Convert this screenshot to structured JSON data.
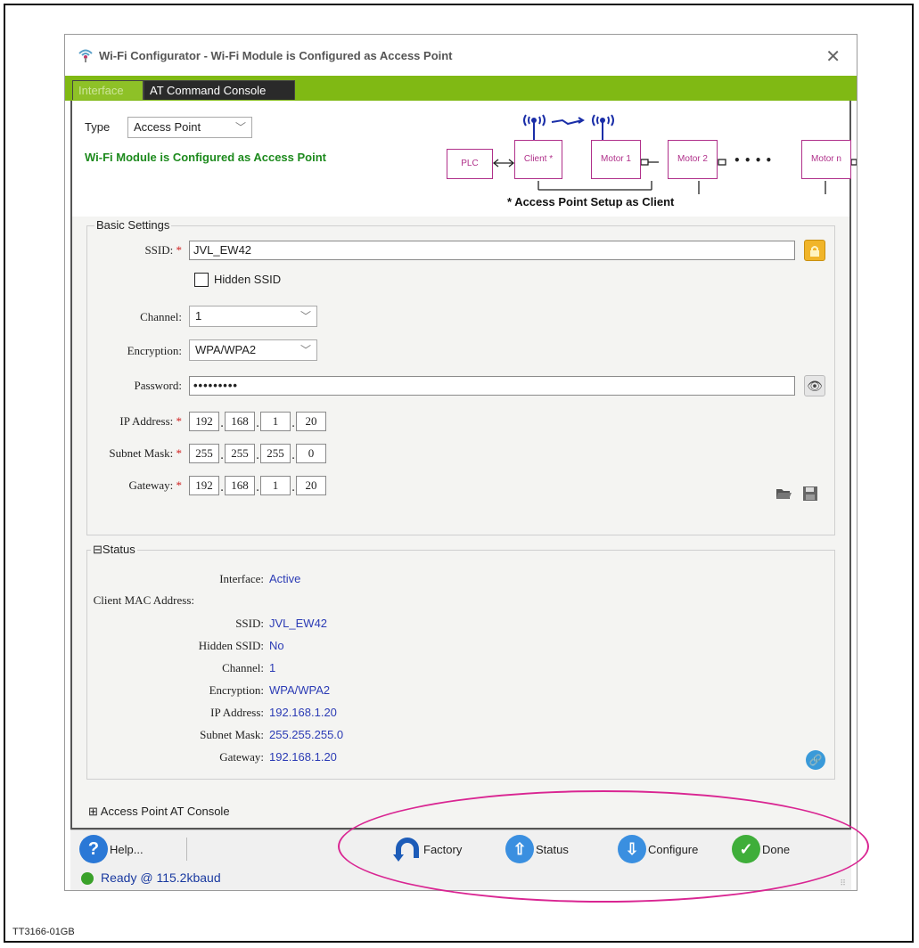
{
  "window": {
    "title": "Wi-Fi Configurator - Wi-Fi Module is Configured as Access Point",
    "tabs": [
      {
        "label": "Interface"
      },
      {
        "label": "AT Command Console"
      }
    ]
  },
  "top": {
    "type_label": "Type",
    "type_value": "Access Point",
    "config_message": "Wi-Fi Module is Configured as Access Point",
    "diagram": {
      "boxes": [
        "PLC",
        "Client *",
        "Motor 1",
        "Motor 2",
        "Motor n"
      ],
      "dots": "• • • •",
      "caption": "* Access Point Setup as Client"
    }
  },
  "basic": {
    "title": "Basic Settings",
    "ssid_label": "SSID:",
    "ssid_value": "JVL_EW42",
    "hidden_ssid_label": "Hidden SSID",
    "channel_label": "Channel:",
    "channel_value": "1",
    "encryption_label": "Encryption:",
    "encryption_value": "WPA/WPA2",
    "password_label": "Password:",
    "password_value": "•••••••••",
    "ip_label": "IP Address:",
    "ip": [
      "192",
      "168",
      "1",
      "20"
    ],
    "subnet_label": "Subnet Mask:",
    "subnet": [
      "255",
      "255",
      "255",
      "0"
    ],
    "gateway_label": "Gateway:",
    "gateway": [
      "192",
      "168",
      "1",
      "20"
    ],
    "required_marker": "*"
  },
  "status": {
    "title": "Status",
    "rows": [
      {
        "label": "Interface:",
        "value": "Active"
      },
      {
        "label": "Client MAC Address:",
        "value": ""
      },
      {
        "label": "SSID:",
        "value": "JVL_EW42"
      },
      {
        "label": "Hidden SSID:",
        "value": "No"
      },
      {
        "label": "Channel:",
        "value": "1"
      },
      {
        "label": "Encryption:",
        "value": "WPA/WPA2"
      },
      {
        "label": "IP Address:",
        "value": "192.168.1.20"
      },
      {
        "label": "Subnet Mask:",
        "value": "255.255.255.0"
      },
      {
        "label": "Gateway:",
        "value": "192.168.1.20"
      }
    ]
  },
  "ap_console": {
    "label": "Access Point AT Console"
  },
  "footer": {
    "help": "Help...",
    "factory": "Factory",
    "status": "Status",
    "configure": "Configure",
    "done": "Done"
  },
  "statusbar": {
    "text": "Ready @ 115.2kbaud"
  },
  "caption": "TT3166-01GB",
  "colors": {
    "accent_green": "#80b914",
    "message_green": "#1d8a1d",
    "value_blue": "#2b3bb5",
    "annotation_magenta": "#d92592"
  }
}
